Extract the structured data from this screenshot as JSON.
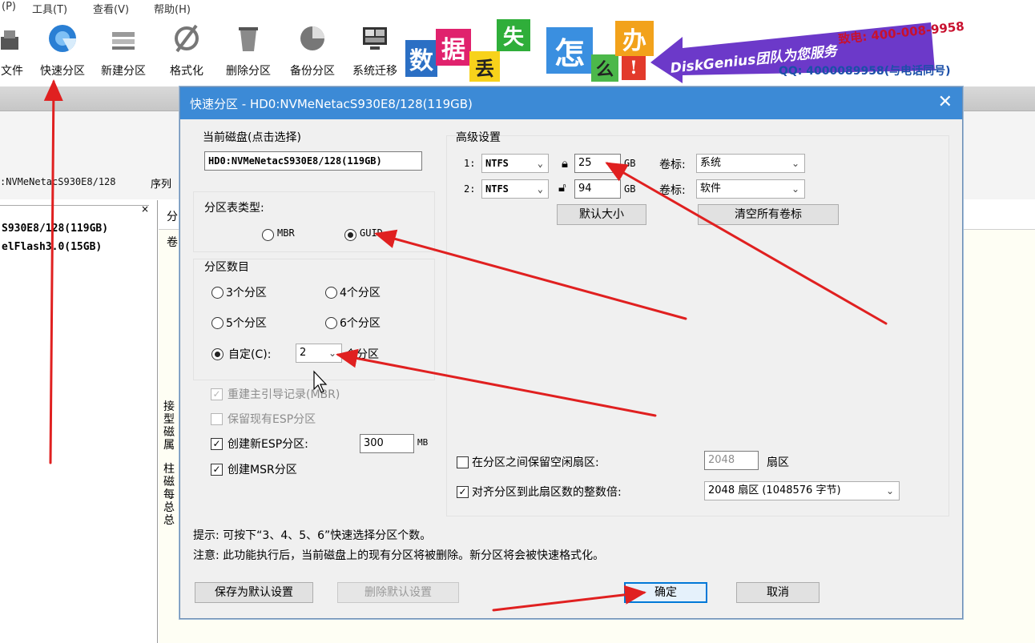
{
  "menu": [
    "(P)",
    "工具(T)",
    "查看(V)",
    "帮助(H)"
  ],
  "toolbar": [
    {
      "label": "文件",
      "icon": "file-icon"
    },
    {
      "label": "快速分区",
      "icon": "quick-partition-icon"
    },
    {
      "label": "新建分区",
      "icon": "new-partition-icon"
    },
    {
      "label": "格式化",
      "icon": "format-icon"
    },
    {
      "label": "删除分区",
      "icon": "delete-partition-icon"
    },
    {
      "label": "备份分区",
      "icon": "backup-partition-icon"
    },
    {
      "label": "系统迁移",
      "icon": "system-migrate-icon"
    }
  ],
  "banner": {
    "tiles": [
      "数",
      "据",
      "丢",
      "失",
      "怎",
      "么",
      "办",
      "!"
    ],
    "brand": "DiskGenius团队为您服务",
    "phone": "致电: 400-008-9958",
    "qq": "QQ: 4000089958(与电话同号)"
  },
  "background": {
    "disk_text": ":NVMeNetacS930E8/128",
    "seq_label": "序列",
    "tree": [
      "S930E8/128(119GB)",
      "elFlash3.0(15GB)"
    ],
    "right_tab": "分",
    "right_label": "卷",
    "side_chars": [
      "接",
      "型",
      "磁",
      "属",
      "柱",
      "磁",
      "每",
      "总",
      "总"
    ]
  },
  "dialog": {
    "title": "快速分区 - HD0:NVMeNetacS930E8/128(119GB)",
    "close": "✕",
    "current_disk_label": "当前磁盘(点击选择)",
    "current_disk_value": "HD0:NVMeNetacS930E8/128(119GB)",
    "partition_table_label": "分区表类型:",
    "mbr": "MBR",
    "guid": "GUID",
    "partition_count_label": "分区数目",
    "count_options": [
      "3个分区",
      "4个分区",
      "5个分区",
      "6个分区"
    ],
    "custom_label": "自定(C):",
    "custom_value": "2",
    "custom_suffix": "个分区",
    "rebuild_mbr": "重建主引导记录(MBR)",
    "keep_esp": "保留现有ESP分区",
    "create_esp": "创建新ESP分区:",
    "esp_size": "300",
    "esp_unit": "MB",
    "create_msr": "创建MSR分区",
    "advanced_label": "高级设置",
    "rows": [
      {
        "index": "1:",
        "fs": "NTFS",
        "size": "25",
        "unit": "GB",
        "vol_label": "卷标:",
        "vol_value": "系统"
      },
      {
        "index": "2:",
        "fs": "NTFS",
        "size": "94",
        "unit": "GB",
        "vol_label": "卷标:",
        "vol_value": "软件"
      }
    ],
    "default_size_btn": "默认大小",
    "clear_labels_btn": "清空所有卷标",
    "reserve_gap_label": "在分区之间保留空闲扇区:",
    "reserve_gap_value": "2048",
    "reserve_gap_unit": "扇区",
    "align_label": "对齐分区到此扇区数的整数倍:",
    "align_value": "2048 扇区 (1048576 字节)",
    "hint": "提示: 可按下“3、4、5、6”快速选择分区个数。",
    "note": "注意: 此功能执行后，当前磁盘上的现有分区将被删除。新分区将会被快速格式化。",
    "save_default_btn": "保存为默认设置",
    "delete_default_btn": "删除默认设置",
    "ok_btn": "确定",
    "cancel_btn": "取消"
  },
  "colors": {
    "title_bar": "#3c8ad6",
    "annotation_arrow": "#e02020"
  }
}
